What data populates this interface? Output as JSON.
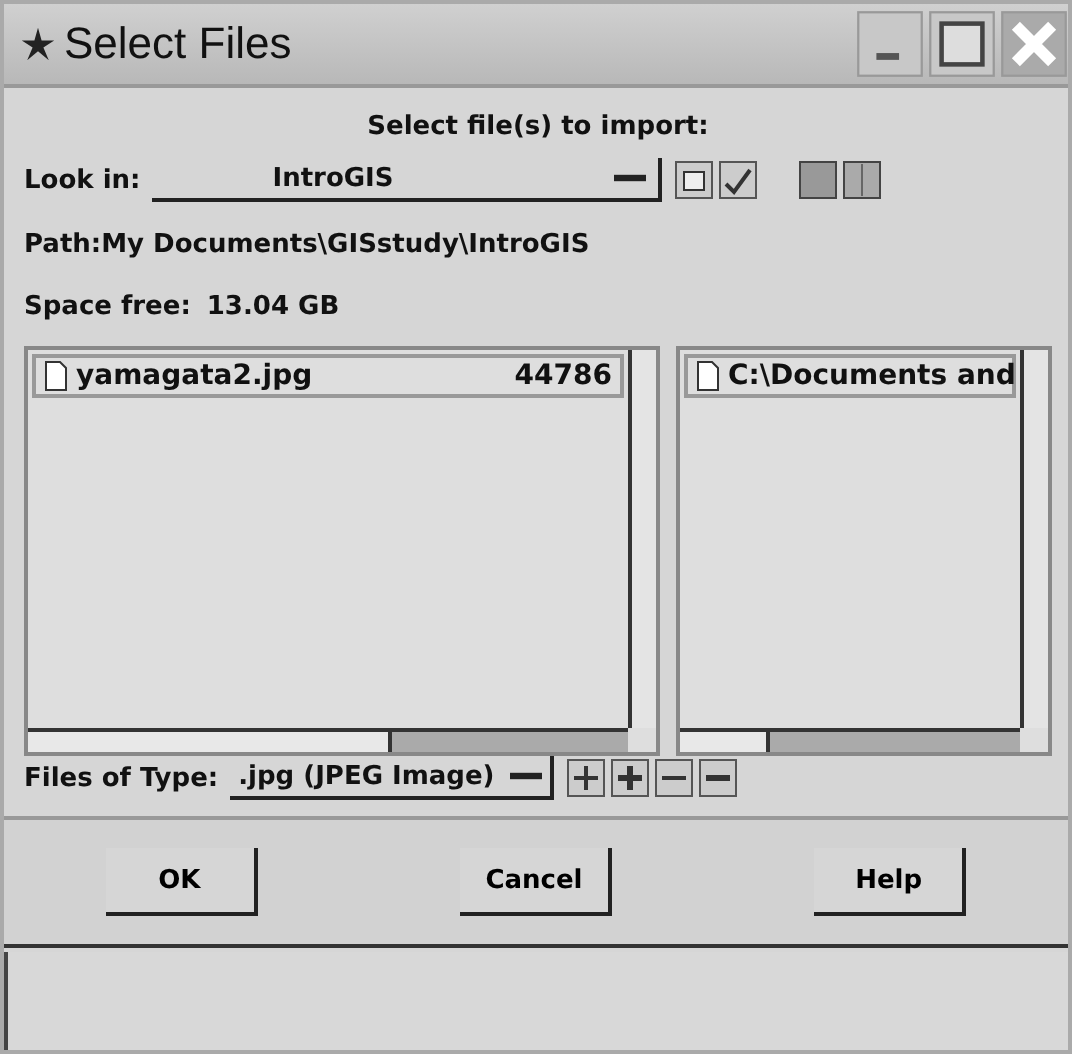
{
  "window": {
    "title": "Select Files"
  },
  "heading": "Select file(s) to import:",
  "look_in": {
    "label": "Look in:",
    "value": "IntroGIS"
  },
  "path": "Path:My Documents\\GISstudy\\IntroGIS",
  "space_free": {
    "label": "Space free:",
    "value": "13.04 GB"
  },
  "file_list": {
    "items": [
      {
        "name": "yamagata2.jpg",
        "size": "44786"
      }
    ]
  },
  "folder_list": {
    "items": [
      {
        "name": "C:\\Documents and"
      }
    ]
  },
  "files_of_type": {
    "label": "Files of Type:",
    "value": ".jpg (JPEG Image)"
  },
  "buttons": [
    "OK",
    "Cancel",
    "Help"
  ]
}
